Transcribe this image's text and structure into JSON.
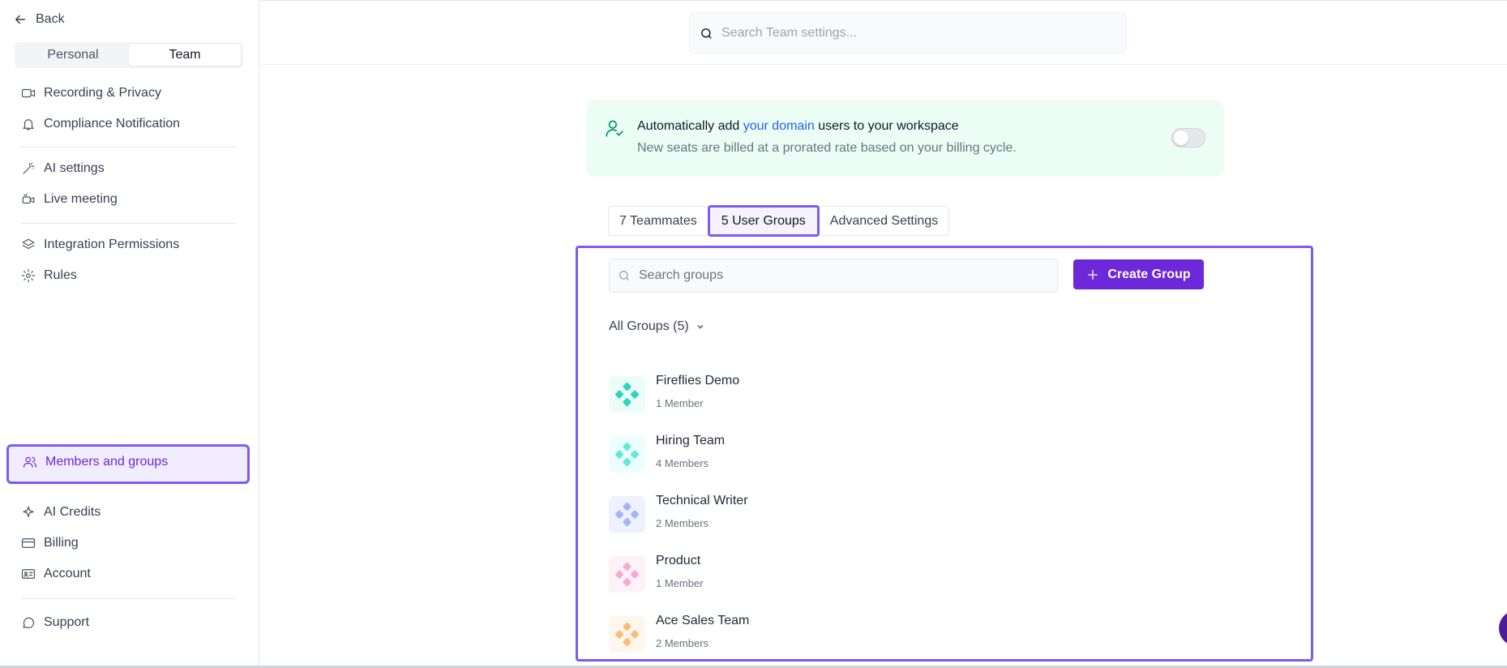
{
  "sidebar": {
    "back_label": "Back",
    "segments": [
      {
        "label": "Personal",
        "active": false
      },
      {
        "label": "Team",
        "active": true
      }
    ],
    "items": [
      {
        "label": "Recording & Privacy",
        "icon": "video-icon"
      },
      {
        "label": "Compliance Notification",
        "icon": "bell-icon"
      },
      {
        "label": "AI settings",
        "icon": "magic-wand-icon"
      },
      {
        "label": "Live meeting",
        "icon": "live-video-icon"
      },
      {
        "label": "Integration Permissions",
        "icon": "layers-icon"
      },
      {
        "label": "Rules",
        "icon": "gear-icon"
      },
      {
        "label": "Members and groups",
        "icon": "users-icon",
        "active": true
      },
      {
        "label": "AI Credits",
        "icon": "sparkle-icon"
      },
      {
        "label": "Billing",
        "icon": "credit-card-icon"
      },
      {
        "label": "Account",
        "icon": "id-card-icon"
      },
      {
        "label": "Support",
        "icon": "chat-icon"
      }
    ]
  },
  "header": {
    "search_placeholder": "Search Team settings..."
  },
  "banner": {
    "text_before": "Automatically add ",
    "link_text": "your domain",
    "text_after": " users to your workspace",
    "subtext": "New seats are billed at a prorated rate based on your billing cycle.",
    "toggle_on": false
  },
  "tabs": [
    {
      "label": "7 Teammates",
      "active": false
    },
    {
      "label": "5 User Groups",
      "active": true
    },
    {
      "label": "Advanced Settings",
      "active": false
    }
  ],
  "groups_panel": {
    "search_placeholder": "Search groups",
    "create_label": "Create Group",
    "filter_label": "All Groups (5)",
    "groups": [
      {
        "name": "Fireflies Demo",
        "members": "1 Member",
        "color": "#2dd4bf",
        "bg": "#ecfdf8"
      },
      {
        "name": "Hiring Team",
        "members": "4 Members",
        "color": "#5eead4",
        "bg": "#ecfeff"
      },
      {
        "name": "Technical Writer",
        "members": "2 Members",
        "color": "#a5b4fc",
        "bg": "#eef2ff"
      },
      {
        "name": "Product",
        "members": "1 Member",
        "color": "#f9a8d4",
        "bg": "#fdf2f8"
      },
      {
        "name": "Ace Sales Team",
        "members": "2 Members",
        "color": "#fdba74",
        "bg": "#fff7ed"
      }
    ]
  },
  "colors": {
    "accent": "#6d28d9",
    "highlight_border": "#7c5cf0",
    "banner_bg": "#ecfdf5",
    "link": "#2563eb"
  }
}
